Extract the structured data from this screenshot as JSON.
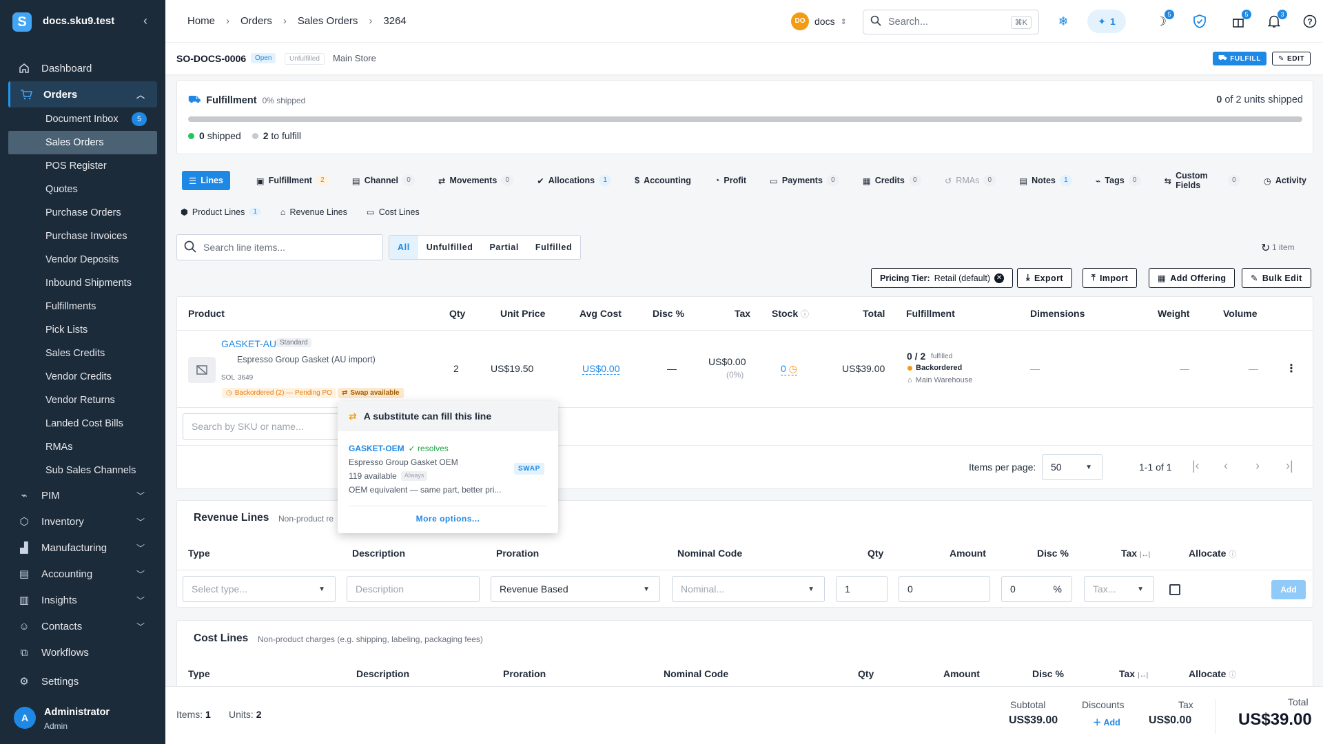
{
  "app": {
    "brand": "docs.sku9.test",
    "logo_letter": "S"
  },
  "sidebar": {
    "dashboard": "Dashboard",
    "orders": "Orders",
    "orders_sub": [
      {
        "label": "Document Inbox",
        "badge": "5"
      },
      {
        "label": "Sales Orders"
      },
      {
        "label": "POS Register"
      },
      {
        "label": "Quotes"
      },
      {
        "label": "Purchase Orders"
      },
      {
        "label": "Purchase Invoices"
      },
      {
        "label": "Vendor Deposits"
      },
      {
        "label": "Inbound Shipments"
      },
      {
        "label": "Fulfillments"
      },
      {
        "label": "Pick Lists"
      },
      {
        "label": "Sales Credits"
      },
      {
        "label": "Vendor Credits"
      },
      {
        "label": "Vendor Returns"
      },
      {
        "label": "Landed Cost Bills"
      },
      {
        "label": "RMAs"
      },
      {
        "label": "Sub Sales Channels"
      }
    ],
    "sections": [
      "PIM",
      "Inventory",
      "Manufacturing",
      "Accounting",
      "Insights",
      "Contacts"
    ],
    "workflows": "Workflows",
    "settings": "Settings",
    "user": {
      "initial": "A",
      "name": "Administrator",
      "role": "Admin"
    }
  },
  "topbar": {
    "breadcrumb": [
      "Home",
      "Orders",
      "Sales Orders",
      "3264"
    ],
    "workspace_initials": "DO",
    "workspace": "docs",
    "search_placeholder": "Search...",
    "search_shortcut": "⌘K",
    "ai_count": "1",
    "badges": {
      "moon": "5",
      "gift": "5",
      "bell": "3"
    }
  },
  "order": {
    "number": "SO-DOCS-0006",
    "status": "Open",
    "fulfillment_status": "Unfulfilled",
    "store": "Main Store",
    "fulfill_btn": "FULFILL",
    "edit_btn": "EDIT"
  },
  "fulfillment": {
    "title": "Fulfillment",
    "pct_label": "0% shipped",
    "units_shipped": "0",
    "units_text": "of 2 units shipped",
    "progress": 0,
    "shipped_num": "0",
    "shipped_label": "shipped",
    "to_fulfill_num": "2",
    "to_fulfill_label": "to fulfill"
  },
  "tabs": [
    {
      "label": "Lines",
      "count": ""
    },
    {
      "label": "Fulfillment",
      "count": "2"
    },
    {
      "label": "Channel",
      "count": "0"
    },
    {
      "label": "Movements",
      "count": "0"
    },
    {
      "label": "Allocations",
      "count": "1"
    },
    {
      "label": "Accounting",
      "count": ""
    },
    {
      "label": "Profit",
      "count": ""
    },
    {
      "label": "Payments",
      "count": "0"
    },
    {
      "label": "Credits",
      "count": "0"
    },
    {
      "label": "RMAs",
      "count": "0"
    },
    {
      "label": "Notes",
      "count": "1"
    },
    {
      "label": "Tags",
      "count": "0"
    },
    {
      "label": "Custom Fields",
      "count": "0"
    },
    {
      "label": "Activity",
      "count": ""
    }
  ],
  "subtabs": [
    {
      "label": "Product Lines",
      "count": "1"
    },
    {
      "label": "Revenue Lines"
    },
    {
      "label": "Cost Lines"
    }
  ],
  "lines_toolbar": {
    "search_placeholder": "Search line items...",
    "filters": [
      "All",
      "Unfulfilled",
      "Partial",
      "Fulfilled"
    ],
    "item_count": "1 item",
    "pricing_tier_label": "Pricing Tier:",
    "pricing_tier_value": "Retail (default)",
    "buttons": [
      "Export",
      "Import",
      "Add Offering",
      "Bulk Edit"
    ]
  },
  "table": {
    "headers": [
      "Product",
      "Qty",
      "Unit Price",
      "Avg Cost",
      "Disc %",
      "Tax",
      "Stock",
      "Total",
      "Fulfillment",
      "Dimensions",
      "Weight",
      "Volume"
    ],
    "row": {
      "sku": "GASKET-AU",
      "type": "Standard",
      "name": "Espresso Group Gasket (AU import)",
      "meta1": "SOL",
      "meta2": "3649",
      "qty": "2",
      "unit_price": "US$19.50",
      "avg_cost": "US$0.00",
      "disc": "—",
      "tax": "US$0.00",
      "tax_pct": "(0%)",
      "stock": "0",
      "total": "US$39.00",
      "fulfilled": "0 / 2",
      "fulfilled_label": "fulfilled",
      "status": "Backordered",
      "warehouse": "Main Warehouse",
      "dimensions": "—",
      "weight": "—",
      "volume": "—",
      "backorder_chip": "Backordered (2) — Pending PO",
      "swap_chip": "Swap available"
    },
    "add_placeholder": "Search by SKU or name...",
    "pager": {
      "label": "Items per page:",
      "value": "50",
      "range": "1-1 of 1"
    }
  },
  "popover": {
    "title": "A substitute can fill this line",
    "sku": "GASKET-OEM",
    "resolves": "✓ resolves",
    "name": "Espresso Group Gasket OEM",
    "available": "119 available",
    "always": "Always",
    "desc": "OEM equivalent — same part, better pri...",
    "swap": "SWAP",
    "more": "More options..."
  },
  "revenue": {
    "title": "Revenue Lines",
    "subtitle": "Non-product re",
    "headers": [
      "Type",
      "Description",
      "Proration",
      "Nominal Code",
      "Qty",
      "Amount",
      "Disc %",
      "Tax",
      "Allocate"
    ],
    "type_placeholder": "Select type...",
    "desc_placeholder": "Description",
    "proration": "Revenue Based",
    "nominal_placeholder": "Nominal...",
    "qty": "1",
    "amount": "0",
    "disc": "0",
    "disc_suffix": "%",
    "tax_placeholder": "Tax...",
    "add": "Add"
  },
  "cost": {
    "title": "Cost Lines",
    "subtitle": "Non-product charges (e.g. shipping, labeling, packaging fees)",
    "headers": [
      "Type",
      "Description",
      "Proration",
      "Nominal Code",
      "Qty",
      "Amount",
      "Disc %",
      "Tax",
      "Allocate"
    ]
  },
  "footer": {
    "items_label": "Items:",
    "items": "1",
    "units_label": "Units:",
    "units": "2",
    "subtotal_label": "Subtotal",
    "subtotal": "US$39.00",
    "discounts_label": "Discounts",
    "discounts_add": "Add",
    "tax_label": "Tax",
    "tax": "US$0.00",
    "total_label": "Total",
    "total": "US$39.00"
  },
  "colors": {
    "accent": "#1e88e5",
    "sidebar": "#1c2b3a",
    "warning": "#f39c12"
  }
}
